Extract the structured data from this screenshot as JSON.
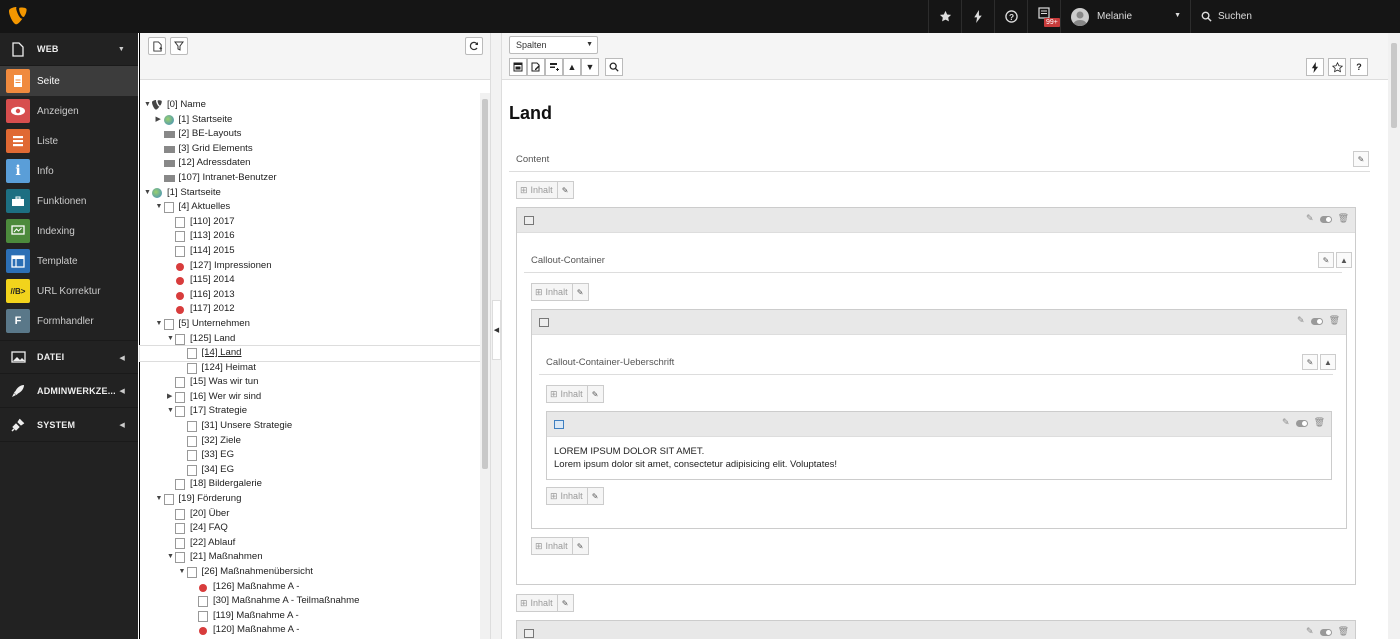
{
  "topbar": {
    "badge": "99+",
    "user": "Melanie",
    "search": "Suchen"
  },
  "modules": {
    "web": "WEB",
    "items": [
      "Seite",
      "Anzeigen",
      "Liste",
      "Info",
      "Funktionen",
      "Indexing",
      "Template",
      "URL Korrektur",
      "Formhandler"
    ],
    "url_icon": "//B>",
    "datei": "DATEI",
    "admin": "ADMINWERKZE...",
    "system": "SYSTEM"
  },
  "tree": [
    {
      "label": "[0] Name",
      "level": 0,
      "icon": "typo3",
      "toggle": "open"
    },
    {
      "label": "[1] Startseite",
      "level": 1,
      "icon": "globe",
      "toggle": "closed"
    },
    {
      "label": "[2] BE-Layouts",
      "level": 1,
      "icon": "folder"
    },
    {
      "label": "[3] Grid Elements",
      "level": 1,
      "icon": "folder"
    },
    {
      "label": "[12] Adressdaten",
      "level": 1,
      "icon": "folder"
    },
    {
      "label": "[107] Intranet-Benutzer",
      "level": 1,
      "icon": "folder"
    },
    {
      "label": "[1] Startseite",
      "level": 0,
      "icon": "globe",
      "toggle": "open"
    },
    {
      "label": "[4] Aktuelles",
      "level": 1,
      "icon": "page",
      "toggle": "open"
    },
    {
      "label": "[110] 2017",
      "level": 2,
      "icon": "page"
    },
    {
      "label": "[113] 2016",
      "level": 2,
      "icon": "page"
    },
    {
      "label": "[114] 2015",
      "level": 2,
      "icon": "page"
    },
    {
      "label": "[127] Impressionen",
      "level": 2,
      "icon": "red"
    },
    {
      "label": "[115] 2014",
      "level": 2,
      "icon": "red"
    },
    {
      "label": "[116] 2013",
      "level": 2,
      "icon": "red"
    },
    {
      "label": "[117] 2012",
      "level": 2,
      "icon": "red"
    },
    {
      "label": "[5] Unternehmen",
      "level": 1,
      "icon": "page",
      "toggle": "open"
    },
    {
      "label": "[125] Land",
      "level": 2,
      "icon": "page",
      "toggle": "open"
    },
    {
      "label": "[14] Land",
      "level": 3,
      "icon": "page",
      "selected": true
    },
    {
      "label": "[124] Heimat",
      "level": 3,
      "icon": "page"
    },
    {
      "label": "[15] Was wir tun",
      "level": 2,
      "icon": "page"
    },
    {
      "label": "[16] Wer wir sind",
      "level": 2,
      "icon": "page",
      "toggle": "closed"
    },
    {
      "label": "[17] Strategie",
      "level": 2,
      "icon": "page",
      "toggle": "open"
    },
    {
      "label": "[31] Unsere Strategie",
      "level": 3,
      "icon": "page"
    },
    {
      "label": "[32] Ziele",
      "level": 3,
      "icon": "page"
    },
    {
      "label": "[33] EG",
      "level": 3,
      "icon": "page"
    },
    {
      "label": "[34] EG",
      "level": 3,
      "icon": "page"
    },
    {
      "label": "[18] Bildergalerie",
      "level": 2,
      "icon": "page"
    },
    {
      "label": "[19] Förderung",
      "level": 1,
      "icon": "page",
      "toggle": "open"
    },
    {
      "label": "[20] Über",
      "level": 2,
      "icon": "page"
    },
    {
      "label": "[24] FAQ",
      "level": 2,
      "icon": "page"
    },
    {
      "label": "[22] Ablauf",
      "level": 2,
      "icon": "page"
    },
    {
      "label": "[21] Maßnahmen",
      "level": 2,
      "icon": "page",
      "toggle": "open"
    },
    {
      "label": "[26] Maßnahmenübersicht",
      "level": 3,
      "icon": "page",
      "toggle": "open"
    },
    {
      "label": "[126] Maßnahme A -",
      "level": 4,
      "icon": "red"
    },
    {
      "label": "[30] Maßnahme A - Teilmaßnahme",
      "level": 4,
      "icon": "page"
    },
    {
      "label": "[119] Maßnahme A -",
      "level": 4,
      "icon": "page"
    },
    {
      "label": "[120] Maßnahme A -",
      "level": 4,
      "icon": "red"
    }
  ],
  "content": {
    "view_select": "Spalten",
    "page_title": "Land",
    "column": "Content",
    "add_label": "Inhalt",
    "container1": "Callout-Container",
    "container2": "Callout-Container-Ueberschrift",
    "text_heading": "LOREM IPSUM DOLOR SIT AMET.",
    "text_body": "Lorem ipsum dolor sit amet, consectetur adipisicing elit. Voluptates!"
  }
}
